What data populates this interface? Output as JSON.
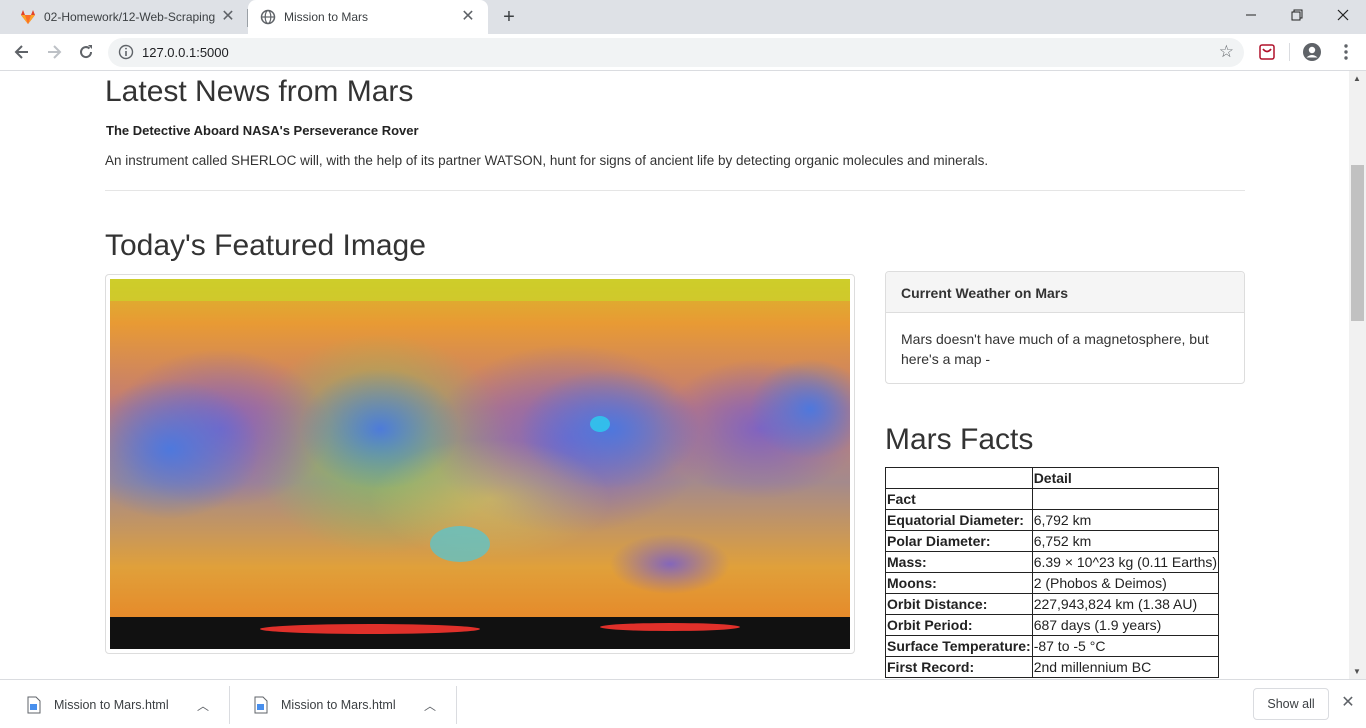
{
  "browser": {
    "tabs": [
      {
        "title": "02-Homework/12-Web-Scraping",
        "icon": "gitlab-fox-icon"
      },
      {
        "title": "Mission to Mars",
        "icon": "globe-icon"
      }
    ],
    "new_tab_label": "+",
    "url": "127.0.0.1:5000",
    "window_controls": {
      "minimize": "—",
      "restore": "❐",
      "close": "✕"
    }
  },
  "news": {
    "section_title": "Latest News from Mars",
    "headline": "The Detective Aboard NASA's Perseverance Rover",
    "teaser": "An instrument called SHERLOC will, with the help of its partner WATSON, hunt for signs of ancient life by detecting organic molecules and minerals."
  },
  "featured": {
    "section_title": "Today's Featured Image"
  },
  "weather": {
    "title": "Current Weather on Mars",
    "text": "Mars doesn't have much of a magnetosphere, but here's a map -"
  },
  "facts": {
    "section_title": "Mars Facts",
    "header_col2": "Detail",
    "index_label": "Fact",
    "rows": [
      {
        "fact": "Equatorial Diameter:",
        "detail": "6,792 km"
      },
      {
        "fact": "Polar Diameter:",
        "detail": "6,752 km"
      },
      {
        "fact": "Mass:",
        "detail": "6.39 × 10^23 kg (0.11 Earths)"
      },
      {
        "fact": "Moons:",
        "detail": "2 (Phobos & Deimos)"
      },
      {
        "fact": "Orbit Distance:",
        "detail": "227,943,824 km (1.38 AU)"
      },
      {
        "fact": "Orbit Period:",
        "detail": "687 days (1.9 years)"
      },
      {
        "fact": "Surface Temperature:",
        "detail": "-87 to -5 °C"
      },
      {
        "fact": "First Record:",
        "detail": "2nd millennium BC"
      }
    ]
  },
  "downloads": {
    "items": [
      {
        "name": "Mission to Mars.html"
      },
      {
        "name": "Mission to Mars.html"
      }
    ],
    "show_all_label": "Show all"
  }
}
